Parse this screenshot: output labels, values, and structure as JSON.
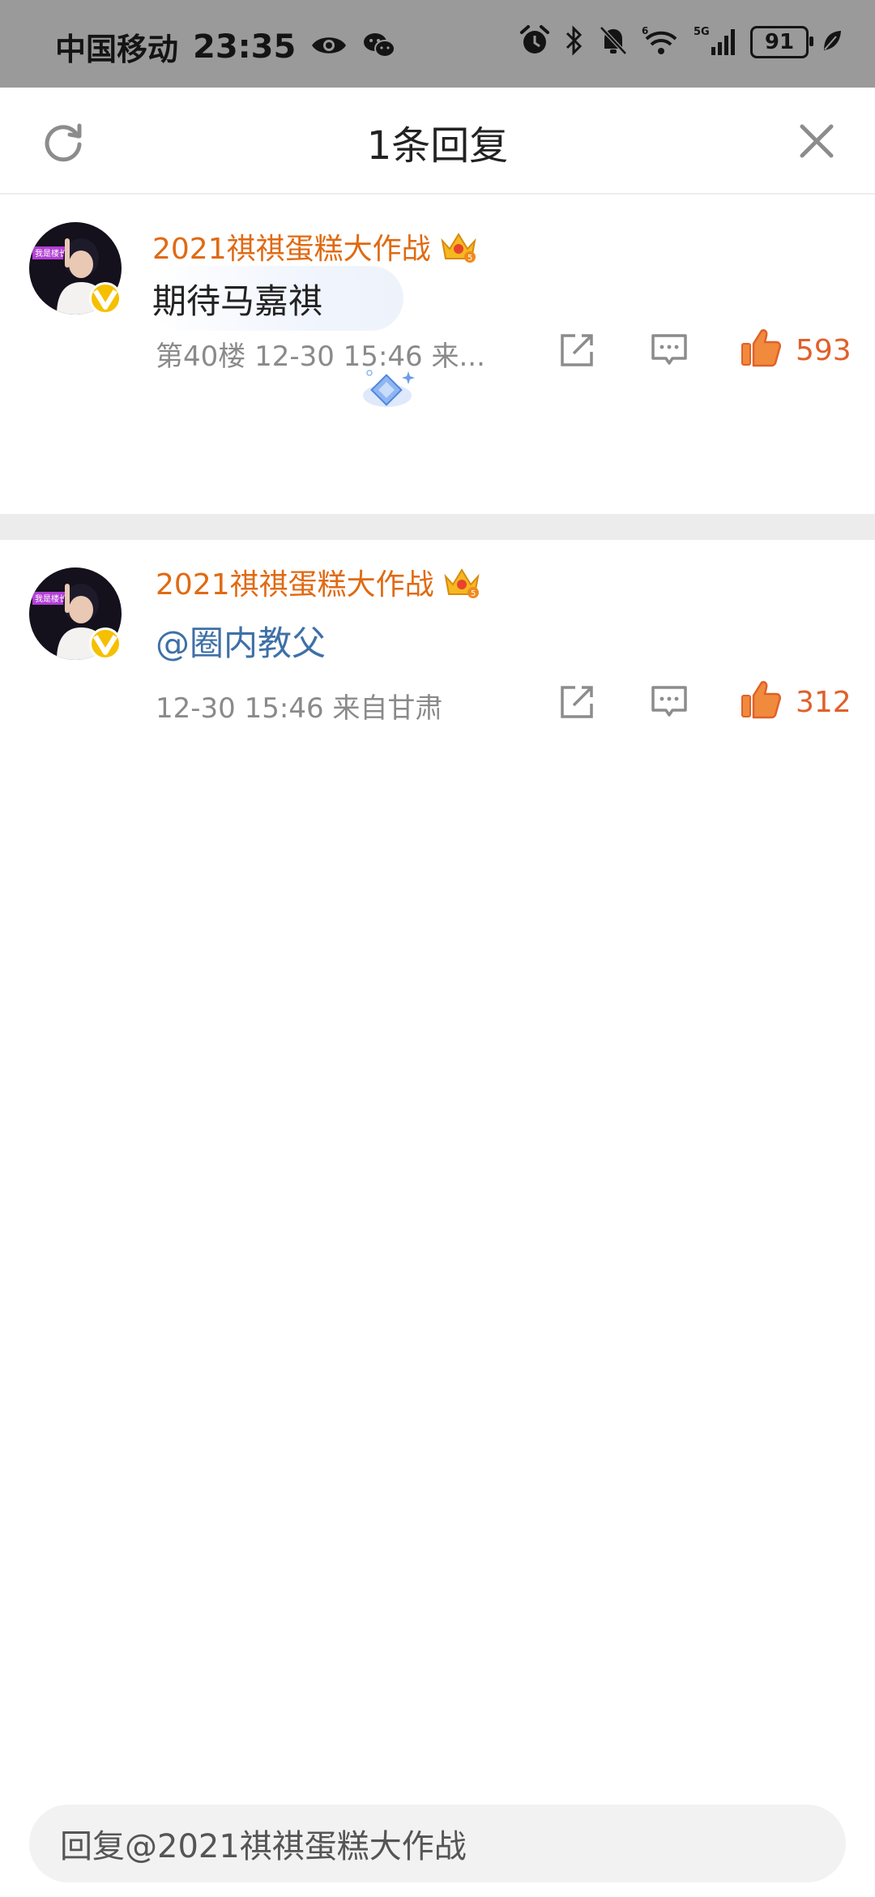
{
  "status_bar": {
    "carrier": "中国移动",
    "time": "23:35",
    "battery": "91",
    "network": "5G",
    "wifi_badge": "6"
  },
  "header": {
    "title": "1条回复"
  },
  "comments": [
    {
      "username": "2021祺祺蛋糕大作战",
      "text": "期待马嘉祺",
      "meta": "第40楼  12-30 15:46  来...",
      "likes": "593"
    },
    {
      "username": "2021祺祺蛋糕大作战",
      "text": "@圈内教父",
      "meta": "12-30 15:46  来自甘肃",
      "likes": "312"
    }
  ],
  "avatar_badge": "我是楼长",
  "reply_input": {
    "placeholder": "回复@2021祺祺蛋糕大作战"
  },
  "colors": {
    "username": "#e06a12",
    "mention": "#3f70a8",
    "like": "#f08a3c"
  }
}
